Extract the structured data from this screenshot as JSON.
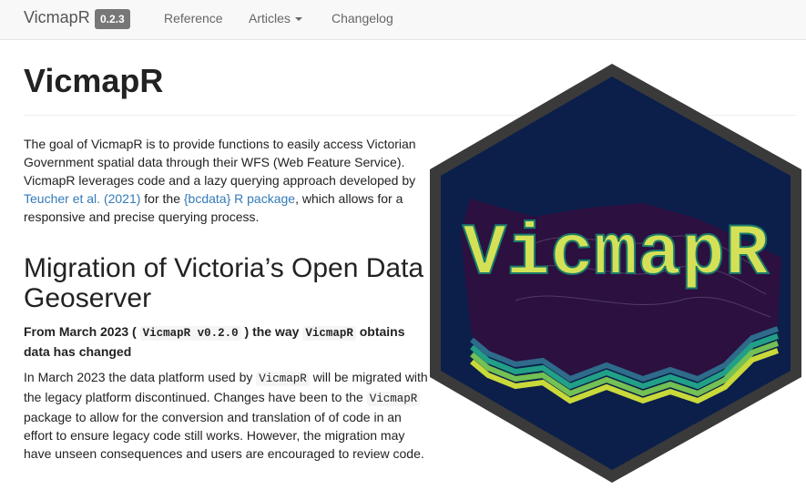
{
  "navbar": {
    "brand": "VicmapR",
    "version": "0.2.3",
    "links": {
      "reference": "Reference",
      "articles": "Articles",
      "changelog": "Changelog"
    }
  },
  "main": {
    "title": "VicmapR",
    "intro": {
      "part1": "The goal of VicmapR is to provide functions to easily access Victorian Government spatial data through their WFS (Web Feature Service). VicmapR leverages code and a lazy querying approach developed by ",
      "link1": "Teucher et al. (2021)",
      "part2": " for the ",
      "link2": "{bcdata} R package",
      "part3": ", which allows for a responsive and precise querying process."
    },
    "section": {
      "title": "Migration of Victoria’s Open Data Geoserver",
      "subhead": {
        "part1": "From March 2023 ( ",
        "code1": "VicmapR v0.2.0",
        "part2": " ) the way ",
        "code2": "VicmapR",
        "part3": " obtains data has changed"
      },
      "para": {
        "part1": "In March 2023 the data platform used by ",
        "code1": "VicmapR",
        "part2": " will be migrated with the legacy platform discontinued. Changes have been to the ",
        "code2": "VicmapR",
        "part3": " package to allow for the conversion and translation of of code in an effort to ensure legacy code still works. However, the migration may have unseen consequences and users are encouraged to review code."
      }
    },
    "logo": {
      "text": "VicmapR",
      "colors": {
        "border": "#3a3a3a",
        "background": "#0b1f4a",
        "text": "#d4e157",
        "map": "#2b1040"
      }
    }
  }
}
